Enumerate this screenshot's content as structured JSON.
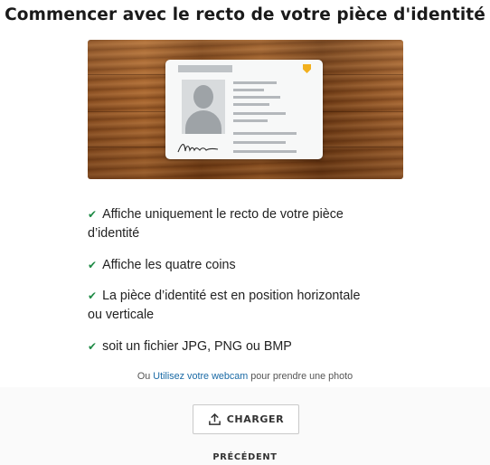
{
  "header": {
    "title": "Commencer avec le recto de votre pièce d'identité"
  },
  "illustration": {
    "alt_icon": "id-card-on-wood",
    "signature_text": "Amsden"
  },
  "requirements": [
    {
      "line1": "Affiche uniquement le recto de votre pièce",
      "line2": "d’identité"
    },
    {
      "line1": "Affiche les quatre coins",
      "line2": ""
    },
    {
      "line1": "La pièce d’identité est en position horizontale",
      "line2": "ou verticale"
    },
    {
      "line1": "soit un fichier JPG, PNG ou BMP",
      "line2": ""
    }
  ],
  "webcam": {
    "prefix": "Ou",
    "link": "Utilisez votre webcam",
    "suffix": "pour prendre une photo"
  },
  "actions": {
    "upload_label": "CHARGER",
    "previous_label": "PRÉCÉDENT"
  },
  "colors": {
    "check": "#1e8a45",
    "link": "#1a6aa5"
  },
  "icons": {
    "check": "check-icon",
    "upload": "upload-icon"
  }
}
